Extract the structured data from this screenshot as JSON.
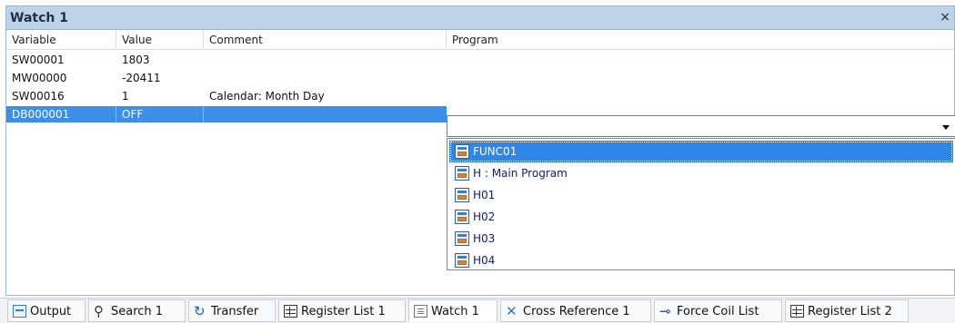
{
  "window": {
    "title": "Watch 1",
    "close": "×"
  },
  "columns": {
    "variable": "Variable",
    "value": "Value",
    "comment": "Comment",
    "program": "Program"
  },
  "rows": [
    {
      "variable": "SW00001",
      "value": "1803",
      "comment": ""
    },
    {
      "variable": "MW00000",
      "value": "-20411",
      "comment": ""
    },
    {
      "variable": "SW00016",
      "value": "1",
      "comment": "Calendar: Month Day"
    },
    {
      "variable": "DB000001",
      "value": "OFF",
      "comment": ""
    }
  ],
  "program_dropdown": {
    "options": [
      "FUNC01",
      "H : Main Program",
      "H01",
      "H02",
      "H03",
      "H04"
    ],
    "highlighted": "FUNC01"
  },
  "tabs": [
    {
      "label": "Output",
      "icon": "output-icon"
    },
    {
      "label": "Search 1",
      "icon": "binoculars-icon"
    },
    {
      "label": "Transfer",
      "icon": "transfer-icon"
    },
    {
      "label": "Register List 1",
      "icon": "register-list-icon"
    },
    {
      "label": "Watch 1",
      "icon": "watch-icon",
      "active": true
    },
    {
      "label": "Cross Reference 1",
      "icon": "cross-reference-icon"
    },
    {
      "label": "Force Coil List",
      "icon": "force-coil-icon"
    },
    {
      "label": "Register List 2",
      "icon": "register-list-icon"
    }
  ],
  "colors": {
    "title_bar": "#bcd3ea",
    "selection": "#3d8ee8",
    "dropdown_highlight": "#2f86e6"
  }
}
